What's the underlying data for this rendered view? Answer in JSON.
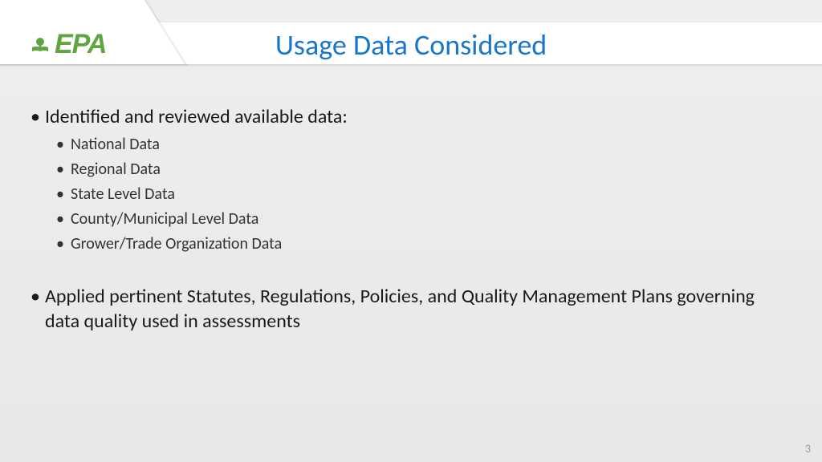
{
  "header": {
    "logo_text": "EPA",
    "title": "Usage Data Considered"
  },
  "content": {
    "items": [
      {
        "level": 1,
        "text": "Identified and reviewed available data:"
      },
      {
        "level": 2,
        "text": "National Data"
      },
      {
        "level": 2,
        "text": "Regional Data"
      },
      {
        "level": 2,
        "text": "State Level Data"
      },
      {
        "level": 2,
        "text": "County/Municipal Level Data"
      },
      {
        "level": 2,
        "text": "Grower/Trade Organization Data"
      },
      {
        "level": 0,
        "text": ""
      },
      {
        "level": 1,
        "text": "Applied pertinent Statutes, Regulations, Policies, and Quality Management Plans governing data quality used in assessments"
      }
    ]
  },
  "footer": {
    "page_number": "3"
  }
}
